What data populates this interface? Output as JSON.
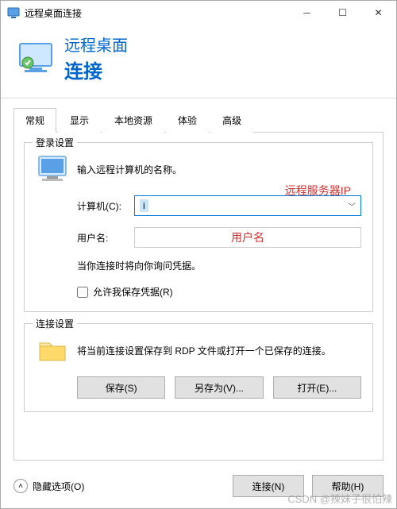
{
  "titlebar": {
    "title": "远程桌面连接"
  },
  "header": {
    "line1": "远程桌面",
    "line2": "连接"
  },
  "tabs": {
    "items": [
      "常规",
      "显示",
      "本地资源",
      "体验",
      "高级"
    ],
    "active": 0
  },
  "login": {
    "group_title": "登录设置",
    "intro": "输入远程计算机的名称。",
    "computer_label": "计算机(C):",
    "computer_value": "i",
    "user_label": "用户名:",
    "hint": "当你连接时将向你询问凭据。",
    "checkbox_label": "允许我保存凭据(R)"
  },
  "conn": {
    "group_title": "连接设置",
    "desc": "将当前连接设置保存到 RDP 文件或打开一个已保存的连接。",
    "save": "保存(S)",
    "save_as": "另存为(V)...",
    "open": "打开(E)..."
  },
  "footer": {
    "hide_options": "隐藏选项(O)",
    "connect": "连接(N)",
    "help": "帮助(H)"
  },
  "annotations": {
    "remote_ip": "远程服务器IP",
    "username": "用户名"
  },
  "watermark": "CSDN @辣妹子很怕辣"
}
